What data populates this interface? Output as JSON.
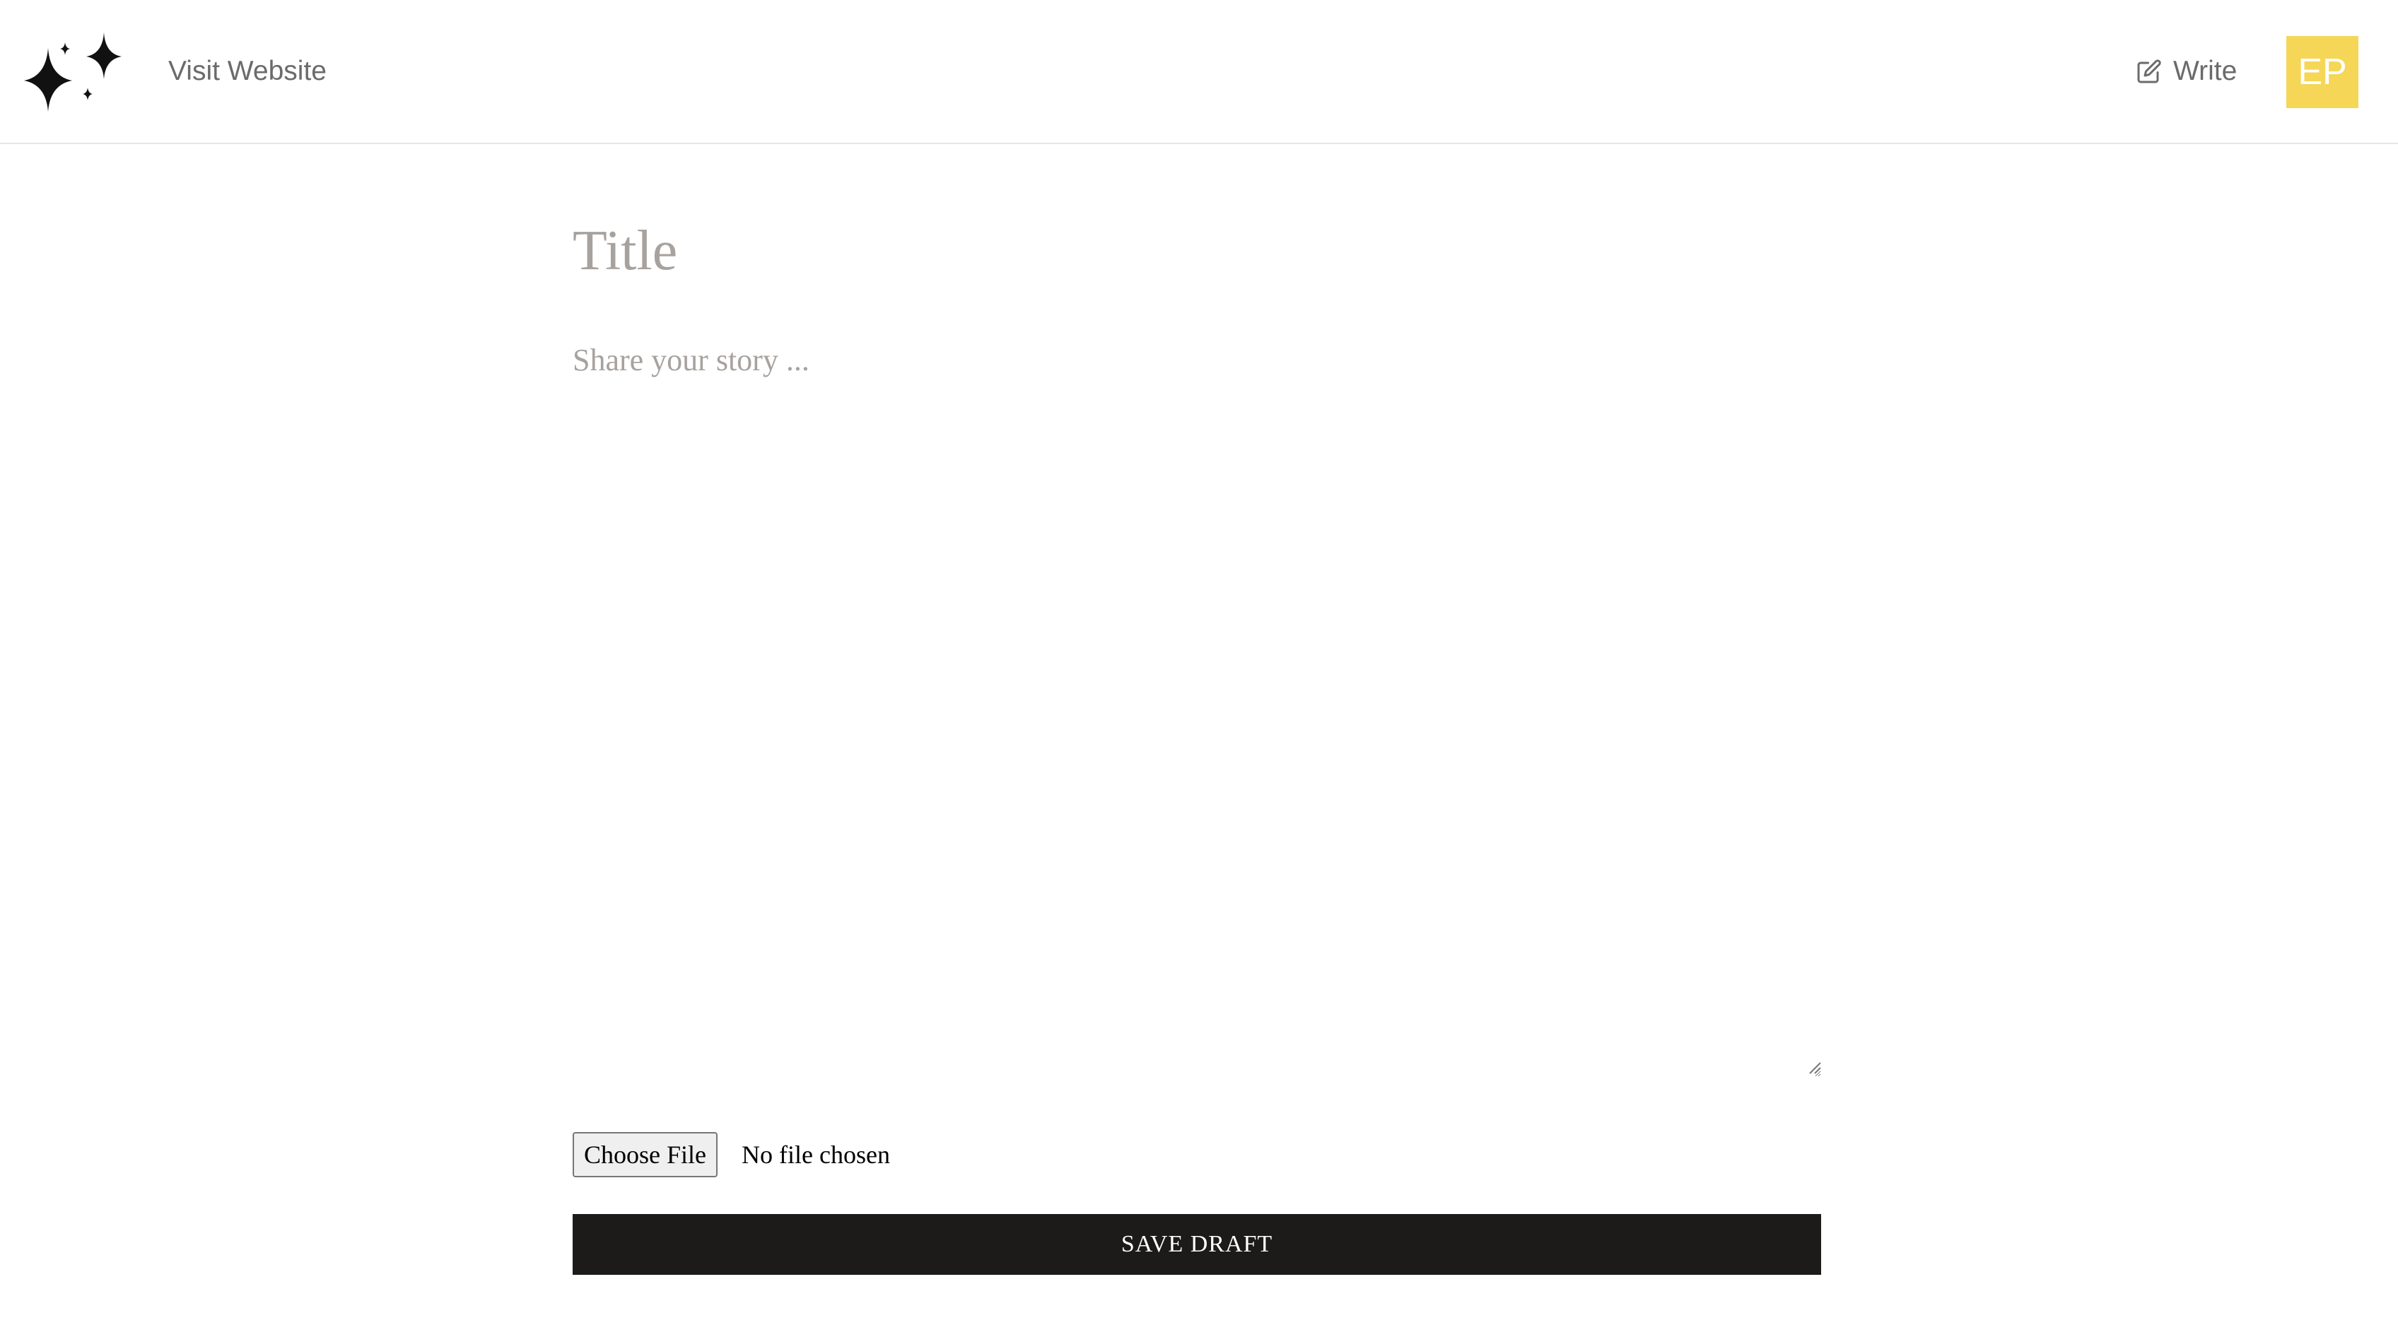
{
  "header": {
    "logo_icon": "sparkles-icon",
    "visit_link_label": "Visit Website",
    "write_icon": "pencil-square-icon",
    "write_label": "Write",
    "avatar_initials": "EP",
    "avatar_color": "#f5d657"
  },
  "editor": {
    "title_value": "",
    "title_placeholder": "Title",
    "story_value": "",
    "story_placeholder": "Share your story ...",
    "choose_file_label": "Choose File",
    "file_status": "No file chosen",
    "save_draft_label": "SAVE DRAFT",
    "save_draft_color": "#1c1b19"
  }
}
